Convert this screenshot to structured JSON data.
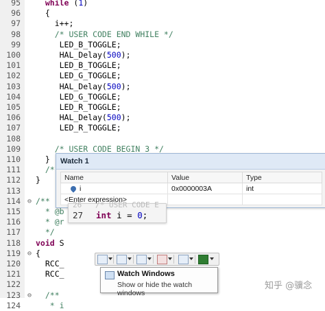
{
  "editor": {
    "lines": [
      {
        "n": "95",
        "fold": "",
        "code": "  while (1)"
      },
      {
        "n": "96",
        "fold": "",
        "code": "  {"
      },
      {
        "n": "97",
        "fold": "",
        "code": "    i++;"
      },
      {
        "n": "98",
        "fold": "",
        "code": "    /* USER CODE END WHILE */"
      },
      {
        "n": "99",
        "fold": "",
        "code": "     LED_B_TOGGLE;"
      },
      {
        "n": "100",
        "fold": "",
        "code": "     HAL_Delay(500);"
      },
      {
        "n": "101",
        "fold": "",
        "code": "     LED_B_TOGGLE;"
      },
      {
        "n": "102",
        "fold": "",
        "code": "     LED_G_TOGGLE;"
      },
      {
        "n": "103",
        "fold": "",
        "code": "     HAL_Delay(500);"
      },
      {
        "n": "104",
        "fold": "",
        "code": "     LED_G_TOGGLE;"
      },
      {
        "n": "105",
        "fold": "",
        "code": "     LED_R_TOGGLE;"
      },
      {
        "n": "106",
        "fold": "",
        "code": "     HAL_Delay(500);"
      },
      {
        "n": "107",
        "fold": "",
        "code": "     LED_R_TOGGLE;"
      },
      {
        "n": "108",
        "fold": "",
        "code": ""
      },
      {
        "n": "109",
        "fold": "",
        "code": "    /* USER CODE BEGIN 3 */"
      },
      {
        "n": "110",
        "fold": "",
        "code": "  }"
      },
      {
        "n": "111",
        "fold": "",
        "code": "  /* t"
      },
      {
        "n": "112",
        "fold": "",
        "code": "}"
      },
      {
        "n": "113",
        "fold": "",
        "code": ""
      },
      {
        "n": "114",
        "fold": "⊖",
        "code": "/**"
      },
      {
        "n": "115",
        "fold": "",
        "code": "  * @b"
      },
      {
        "n": "116",
        "fold": "",
        "code": "  * @r"
      },
      {
        "n": "117",
        "fold": "",
        "code": "  */"
      },
      {
        "n": "118",
        "fold": "",
        "code": "void S"
      },
      {
        "n": "119",
        "fold": "⊖",
        "code": "{"
      },
      {
        "n": "120",
        "fold": "",
        "code": "  RCC_"
      },
      {
        "n": "121",
        "fold": "",
        "code": "  RCC_"
      },
      {
        "n": "122",
        "fold": "",
        "code": ""
      },
      {
        "n": "123",
        "fold": "⊖",
        "code": "  /**"
      },
      {
        "n": "124",
        "fold": "",
        "code": "   * i"
      }
    ]
  },
  "watch": {
    "title": "Watch 1",
    "columns": [
      "Name",
      "Value",
      "Type"
    ],
    "rows": [
      {
        "name": "i",
        "value": "0x0000003A",
        "type": "int"
      },
      {
        "name": "<Enter expression>",
        "value": "",
        "type": ""
      }
    ]
  },
  "hover": {
    "ghost": "26   /* USER CODE E",
    "line_number": "27",
    "code": "int i = 0;"
  },
  "toolbar": {
    "icons": [
      "watch-window-icon",
      "memory-icon",
      "registers-icon",
      "call-stack-icon",
      "serial-icon",
      "logic-analyzer-icon"
    ]
  },
  "tooltip": {
    "title": "Watch Windows",
    "description": "Show or hide the watch windows"
  },
  "watermark": "知乎 @骥念"
}
